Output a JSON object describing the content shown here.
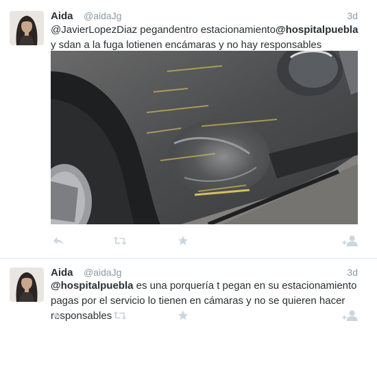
{
  "colors": {
    "muted": "#8899a6",
    "text": "#292f33",
    "divider": "#e1e8ed",
    "icon": "#ccd6dd"
  },
  "tweets": [
    {
      "name": "Aida",
      "handle": "@aidaJg",
      "time": "3d",
      "text_parts": [
        "@JavierLopezDiaz",
        " pegandentro estacionamiento",
        "@hospitalpuebla",
        " y sdan a la fuga lotienen encámaras y no hay responsables"
      ],
      "media": "photo of dented car bumper",
      "actions": [
        "reply-icon",
        "retweet-icon",
        "star-icon",
        "follow-icon"
      ]
    },
    {
      "name": "Aida",
      "handle": "@aidaJg",
      "time": "3d",
      "text_parts": [
        "@hospitalpuebla",
        " es una porquería t pegan en su estacionamiento pagas por el servicio lo tienen en cámaras y no se quieren hacer responsables"
      ],
      "actions": [
        "reply-icon",
        "retweet-icon",
        "star-icon",
        "follow-icon"
      ]
    }
  ]
}
